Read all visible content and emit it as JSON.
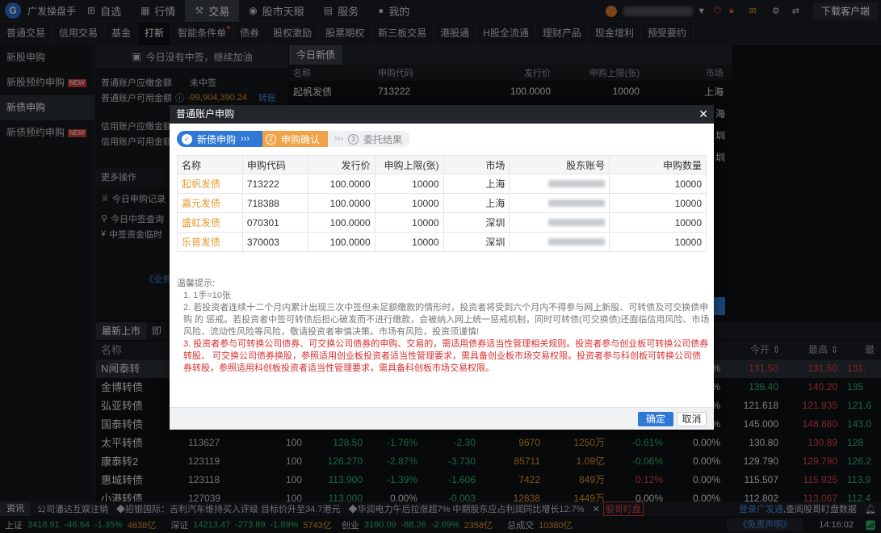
{
  "app": {
    "name": "广发操盘手",
    "logo_letter": "G"
  },
  "topnav": [
    {
      "label": "自选",
      "icon": "plus-square-icon"
    },
    {
      "label": "行情",
      "icon": "chart-icon"
    },
    {
      "label": "交易",
      "icon": "gavel-icon",
      "active": true
    },
    {
      "label": "股市天眼",
      "icon": "eye-icon"
    },
    {
      "label": "服务",
      "icon": "briefcase-icon"
    },
    {
      "label": "我的",
      "icon": "user-icon"
    }
  ],
  "topright": {
    "download": "下载客户端"
  },
  "subtabs": [
    {
      "label": "普通交易"
    },
    {
      "label": "信用交易"
    },
    {
      "label": "基金"
    },
    {
      "label": "打新",
      "active": true
    },
    {
      "label": "智能条件单",
      "dot": true
    },
    {
      "label": "债券"
    },
    {
      "label": "股权激励"
    },
    {
      "label": "股票期权"
    },
    {
      "label": "新三板交易"
    },
    {
      "label": "港股通"
    },
    {
      "label": "H股全流通"
    },
    {
      "label": "理财产品"
    },
    {
      "label": "现金增利"
    },
    {
      "label": "预受要约"
    }
  ],
  "leftnav": [
    {
      "label": "新股申购"
    },
    {
      "label": "新股预约申购",
      "badge": "NEW"
    },
    {
      "label": "新债申购",
      "active": true
    },
    {
      "label": "新债预约申购",
      "badge": "NEW"
    }
  ],
  "midpanel": {
    "banner": "今日没有中签，继续加油",
    "normal_due_label": "普通账户应缴金额",
    "normal_due_value": "未中签",
    "normal_avail_label": "普通账户可用金额",
    "normal_avail_value": "-99,904,390.24",
    "transfer": "转账",
    "credit_due_label": "信用账户应缴金额",
    "credit_avail_label": "信用账户可用金额",
    "more_ops": "更多操作",
    "op1": "今日申购记录",
    "op2": "今日中签查询",
    "op3": "中签资金临时",
    "business_link": "《业务"
  },
  "righttable": {
    "tab": "今日新债",
    "columns": [
      "名称",
      "申购代码",
      "发行价",
      "申购上限(张)",
      "市场"
    ],
    "row": [
      "起帆发债",
      "713222",
      "100.0000",
      "10000",
      "上海"
    ],
    "side_markets": [
      "海",
      "圳",
      "圳"
    ]
  },
  "lowertabs": [
    {
      "label": "最新上市",
      "active": true
    },
    {
      "label": "即"
    }
  ],
  "lowerhead": {
    "name": "名称",
    "open": "今开",
    "high": "最高",
    "last": "最"
  },
  "lowerrows": [
    {
      "name": "N闻泰转",
      "code": "",
      "lot": "",
      "price": "",
      "pct": "",
      "chg": "",
      "vol": "",
      "amt": "",
      "r1": "",
      "r2": "%",
      "open": "131.50",
      "high": "131.50",
      "last": "131.",
      "hl": true
    },
    {
      "name": "金博转债",
      "code": "",
      "lot": "",
      "price": "",
      "pct": "",
      "chg": "",
      "vol": "",
      "amt": "",
      "r1": "",
      "r2": "%",
      "open": "136.40",
      "high": "140.20",
      "last": "135"
    },
    {
      "name": "弘亚转债",
      "code": "",
      "lot": "",
      "price": "",
      "pct": "",
      "chg": "",
      "vol": "",
      "amt": "",
      "r1": "",
      "r2": "%",
      "open": "121.618",
      "high": "121.935",
      "last": "121.6"
    },
    {
      "name": "国泰转债",
      "code": "",
      "lot": "",
      "price": "",
      "pct": "",
      "chg": "",
      "vol": "",
      "amt": "",
      "r1": "",
      "r2": "%",
      "open": "145.000",
      "high": "148.880",
      "last": "143.0"
    },
    {
      "name": "太平转债",
      "code": "113627",
      "lot": "100",
      "price": "128.50",
      "pct": "-1.76%",
      "chg": "-2.30",
      "vol": "9670",
      "amt": "1250万",
      "r1": "-0.61%",
      "r2": "0.00%",
      "open": "130.80",
      "high": "130.89",
      "last": "128"
    },
    {
      "name": "康泰转2",
      "code": "123119",
      "lot": "100",
      "price": "126.270",
      "pct": "-2.87%",
      "chg": "-3.730",
      "vol": "85711",
      "amt": "1.09亿",
      "r1": "-0.06%",
      "r2": "0.00%",
      "open": "129.790",
      "high": "129.790",
      "last": "126.2"
    },
    {
      "name": "惠城转债",
      "code": "123118",
      "lot": "100",
      "price": "113.900",
      "pct": "-1.39%",
      "chg": "-1.606",
      "vol": "7422",
      "amt": "849万",
      "r1": "0.12%",
      "r2": "0.00%",
      "open": "115.507",
      "high": "115.925",
      "last": "113.9"
    },
    {
      "name": "小港转债",
      "code": "127039",
      "lot": "100",
      "price": "113.000",
      "pct": "0.00%",
      "chg": "-0.003",
      "vol": "12838",
      "amt": "1449万",
      "r1": "0.00%",
      "r2": "0.00%",
      "open": "112.802",
      "high": "113.067",
      "last": "112.4"
    }
  ],
  "ticker1": {
    "label": "资讯",
    "items": [
      "公司潘达互娱注销",
      "◆招银国际：吉利汽车维持买入评级 目标价升至34.7港元",
      "◆华润电力午后拉涨超7% 中期股东应占利润同比增长12.7%"
    ],
    "badge": "股哥盯盘",
    "login": "登录广发通",
    "check": ",查阅股哥盯盘数据"
  },
  "ticker2": {
    "sh_label": "上证",
    "sh_val": "3418.91",
    "sh_chg": "-46.64",
    "sh_pct": "-1.35%",
    "sh_amt": "4638亿",
    "sz_label": "深证",
    "sz_val": "14213.47",
    "sz_chg": "-273.89",
    "sz_pct": "-1.89%",
    "sz_amt": "5743亿",
    "cy_label": "创业",
    "cy_val": "3190.09",
    "cy_chg": "-88.26",
    "cy_pct": "-2.69%",
    "cy_amt": "2358亿",
    "total_label": "总成交",
    "total_amt": "10380亿",
    "disclaimer": "《免责声明》",
    "time": "14:16:02"
  },
  "dialog": {
    "title": "普通账户申购",
    "steps": [
      {
        "num": "✓",
        "label": "新债申购",
        "state": "done"
      },
      {
        "num": "2",
        "label": "申购确认",
        "state": "active"
      },
      {
        "num": "3",
        "label": "委托结果",
        "state": "todo"
      }
    ],
    "headers": [
      "名称",
      "申购代码",
      "发行价",
      "申购上限(张)",
      "市场",
      "股东账号",
      "申购数量"
    ],
    "rows": [
      [
        "起帆发债",
        "713222",
        "100.0000",
        "10000",
        "上海",
        "",
        "10000"
      ],
      [
        "嘉元发债",
        "718388",
        "100.0000",
        "10000",
        "上海",
        "",
        "10000"
      ],
      [
        "盛虹发债",
        "070301",
        "100.0000",
        "10000",
        "深圳",
        "",
        "10000"
      ],
      [
        "乐普发债",
        "370003",
        "100.0000",
        "10000",
        "深圳",
        "",
        "10000"
      ]
    ],
    "tips_title": "温馨提示:",
    "tip1": "1. 1手=10张",
    "tip2": "2. 若投资者连续十二个月内累计出现三次中签但未足额缴款的情形时，投资者将受到六个月内不得参与网上新股、可转债及可交换债申购 的 惩戒。若投资者中签可转债后担心破发而不进行缴款，会被纳入网上统一惩戒机制，同时可转债(可交换债)还面临信用风险、市场风险、流动性风险等风险，敬请投资者审慎决策。市场有风险，投资须谨慎!",
    "tip3": "3. 投资者参与可转换公司债券、可交换公司债券的申购、交易的，需适用债券适当性管理相关规则。投资者参与创业板可转换公司债券转股、 可交换公司债券换股，参照适用创业板投资者适当性管理要求，需具备创业板市场交易权限。投资者参与科创板可转换公司债券转股，参照适用科创板投资者适当性管理要求，需具备科创板市场交易权限。",
    "ok": "确定",
    "cancel": "取消"
  }
}
